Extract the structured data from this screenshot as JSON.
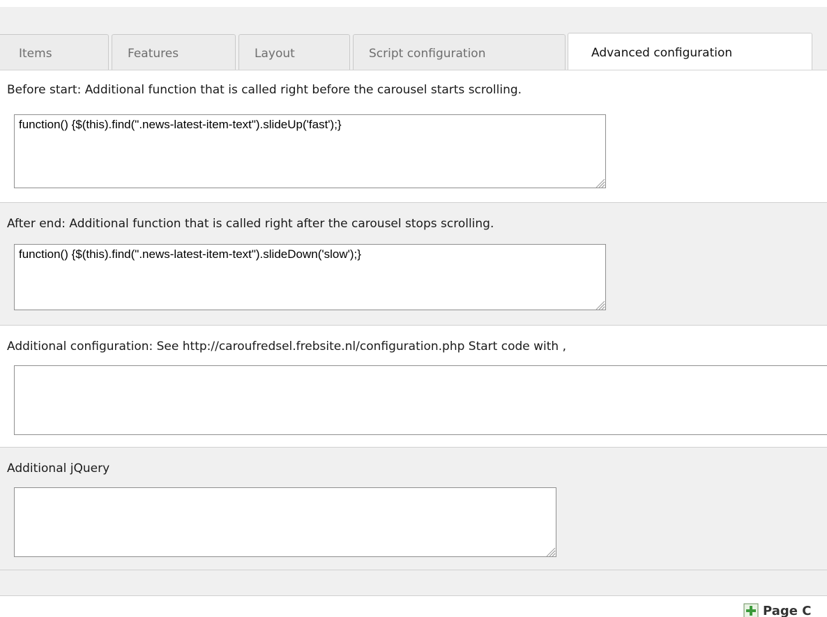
{
  "tabs": [
    {
      "label": "Items"
    },
    {
      "label": "Features"
    },
    {
      "label": "Layout"
    },
    {
      "label": "Script configuration"
    },
    {
      "label": "Advanced configuration",
      "active": true
    }
  ],
  "fields": {
    "before_start": {
      "label": "Before start: Additional function that is called right before the carousel starts scrolling.",
      "value": "function() {$(this).find(\".news-latest-item-text\").slideUp('fast');}"
    },
    "after_end": {
      "label": "After end: Additional function that is called right after the carousel stops scrolling.",
      "value": "function() {$(this).find(\".news-latest-item-text\").slideDown('slow');}"
    },
    "additional_configuration": {
      "label": "Additional configuration: See http://caroufredsel.frebsite.nl/configuration.php Start code with ,",
      "value": ""
    },
    "additional_jquery": {
      "label": "Additional jQuery",
      "value": ""
    }
  },
  "footer": {
    "page_button_label": "Page C"
  },
  "colors": {
    "background": "#f0f0f0",
    "active_tab": "#ffffff",
    "inactive_tab": "#ececec",
    "plus_icon": "#3a9a3a"
  }
}
